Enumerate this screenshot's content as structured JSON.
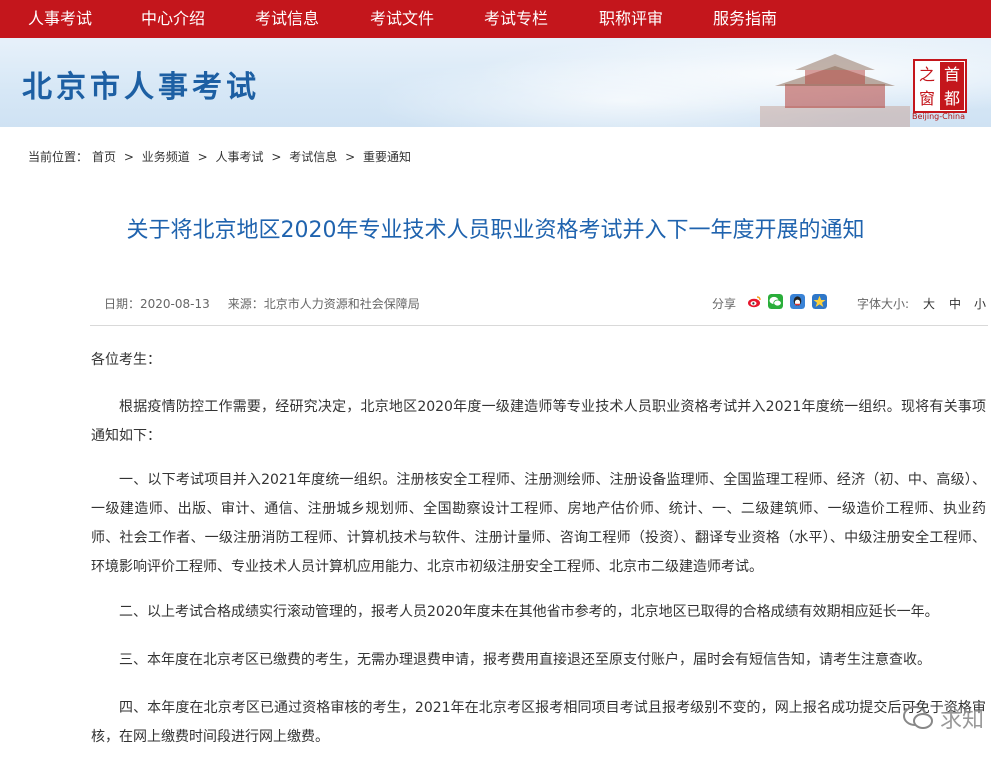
{
  "nav": {
    "items": [
      "人事考试",
      "中心介绍",
      "考试信息",
      "考试文件",
      "考试专栏",
      "职称评审",
      "服务指南"
    ]
  },
  "banner": {
    "site_title": "北京市人事考试",
    "stamp_chars": [
      "首",
      "都",
      "之",
      "窗"
    ],
    "stamp_caption": "Beijing-China"
  },
  "breadcrumb": {
    "label": "当前位置：",
    "items": [
      "首页",
      "业务频道",
      "人事考试",
      "考试信息",
      "重要通知"
    ],
    "separator": ">"
  },
  "article": {
    "title": "关于将北京地区2020年专业技术人员职业资格考试并入下一年度开展的通知",
    "date": "日期：2020-08-13",
    "source": "来源：北京市人力资源和社会保障局",
    "share_label": "分享",
    "share_icons": [
      "weibo-icon",
      "wechat-icon",
      "qq-icon",
      "qzone-icon"
    ],
    "font_size_label": "字体大小:",
    "font_sizes": [
      "大",
      "中",
      "小"
    ],
    "greeting": "各位考生：",
    "paragraphs": [
      "根据疫情防控工作需要，经研究决定，北京地区2020年度一级建造师等专业技术人员职业资格考试并入2021年度统一组织。现将有关事项通知如下：",
      "一、以下考试项目并入2021年度统一组织。注册核安全工程师、注册测绘师、注册设备监理师、全国监理工程师、经济（初、中、高级）、一级建造师、出版、审计、通信、注册城乡规划师、全国勘察设计工程师、房地产估价师、统计、一、二级建筑师、一级造价工程师、执业药师、社会工作者、一级注册消防工程师、计算机技术与软件、注册计量师、咨询工程师（投资）、翻译专业资格（水平）、中级注册安全工程师、环境影响评价工程师、专业技术人员计算机应用能力、北京市初级注册安全工程师、北京市二级建造师考试。",
      "二、以上考试合格成绩实行滚动管理的，报考人员2020年度未在其他省市参考的，北京地区已取得的合格成绩有效期相应延长一年。",
      "三、本年度在北京考区已缴费的考生，无需办理退费申请，报考费用直接退还至原支付账户，届时会有短信告知，请考生注意查收。",
      "四、本年度在北京考区已通过资格审核的考生，2021年在北京考区报考相同项目考试且报考级别不变的，网上报名成功提交后可免于资格审核，在网上缴费时间段进行网上缴费。"
    ]
  },
  "watermark": {
    "text": "求知"
  },
  "colors": {
    "nav_bg": "#c4161c",
    "title_blue": "#1f63ae",
    "banner_blue": "#1d5fa3"
  }
}
